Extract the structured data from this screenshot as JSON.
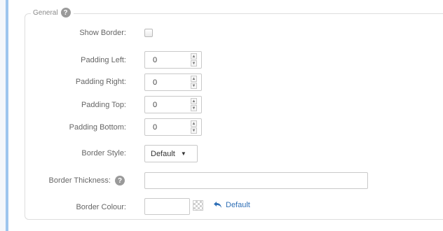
{
  "section": {
    "title": "General",
    "help_icon": "question-circle-icon"
  },
  "fields": {
    "show_border": {
      "label": "Show Border:",
      "checked": false
    },
    "padding_left": {
      "label": "Padding Left:",
      "value": "0"
    },
    "padding_right": {
      "label": "Padding Right:",
      "value": "0"
    },
    "padding_top": {
      "label": "Padding Top:",
      "value": "0"
    },
    "padding_bottom": {
      "label": "Padding Bottom:",
      "value": "0"
    },
    "border_style": {
      "label": "Border Style:",
      "selected": "Default"
    },
    "border_thickness": {
      "label": "Border Thickness:",
      "value": "",
      "help_icon": "question-circle-icon"
    },
    "border_colour": {
      "label": "Border Colour:",
      "value": "",
      "default_link": "Default",
      "icon": "undo-arrow-icon"
    }
  },
  "colors": {
    "accent_bar": "#9dc5ee",
    "link": "#2f6fb6"
  }
}
